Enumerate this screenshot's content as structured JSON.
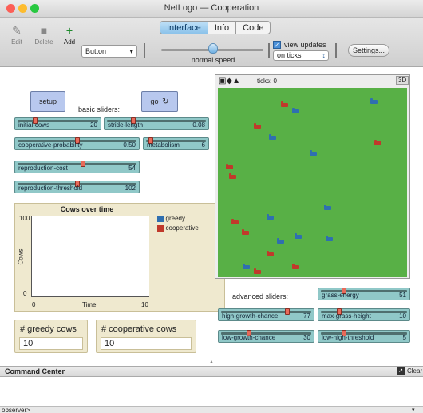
{
  "window": {
    "title": "NetLogo — Cooperation",
    "tabs": [
      "Interface",
      "Info",
      "Code"
    ],
    "active_tab": "Interface"
  },
  "toolbar": {
    "edit_label": "Edit",
    "delete_label": "Delete",
    "add_label": "Add",
    "widget_select": "Button",
    "speed_label": "normal speed",
    "view_updates_label": "view updates",
    "view_updates_checked": true,
    "update_mode": "on ticks",
    "settings_label": "Settings..."
  },
  "buttons": {
    "setup": "setup",
    "go": "go"
  },
  "labels": {
    "basic": "basic sliders:",
    "advanced": "advanced sliders:"
  },
  "sliders": {
    "initial_cows": {
      "label": "initial-cows",
      "value": "20",
      "fraction": 0.2
    },
    "stride_length": {
      "label": "stride-length",
      "value": "0.08",
      "fraction": 0.25
    },
    "cooperative_probability": {
      "label": "cooperative-probability",
      "value": "0.50",
      "fraction": 0.5
    },
    "metabolism": {
      "label": "metabolism",
      "value": "6",
      "fraction": 0.05
    },
    "reproduction_cost": {
      "label": "reproduction-cost",
      "value": "54",
      "fraction": 0.55
    },
    "reproduction_threshold": {
      "label": "reproduction-threshold",
      "value": "102",
      "fraction": 0.5
    },
    "grass_energy": {
      "label": "grass-energy",
      "value": "51",
      "fraction": 0.25
    },
    "high_growth_chance": {
      "label": "high-growth-chance",
      "value": "77",
      "fraction": 0.75
    },
    "max_grass_height": {
      "label": "max-grass-height",
      "value": "10",
      "fraction": 0.2
    },
    "low_growth_chance": {
      "label": "low-growth-chance",
      "value": "30",
      "fraction": 0.3
    },
    "low_high_threshold": {
      "label": "low-high-threshold",
      "value": "5",
      "fraction": 0.25
    }
  },
  "plot": {
    "title": "Cows over time",
    "ylabel": "Cows",
    "xlabel": "Time",
    "y_max_label": "100",
    "y_min_label": "0",
    "x_min_label": "0",
    "x_max_label": "10",
    "legend": [
      {
        "name": "greedy",
        "color": "#2f6fb0"
      },
      {
        "name": "cooperative",
        "color": "#c0392b"
      }
    ]
  },
  "monitors": {
    "greedy": {
      "label": "# greedy cows",
      "value": "10"
    },
    "cooperative": {
      "label": "# cooperative cows",
      "value": "10"
    }
  },
  "view": {
    "ticks_label": "ticks: 0",
    "three_d_label": "3D",
    "grass_color": "#58b046",
    "greedy_color": "#2f6fb0",
    "cooperative_color": "#c0392b"
  },
  "command_center": {
    "title": "Command Center",
    "clear_label": "Clear",
    "prompt": "observer>"
  }
}
